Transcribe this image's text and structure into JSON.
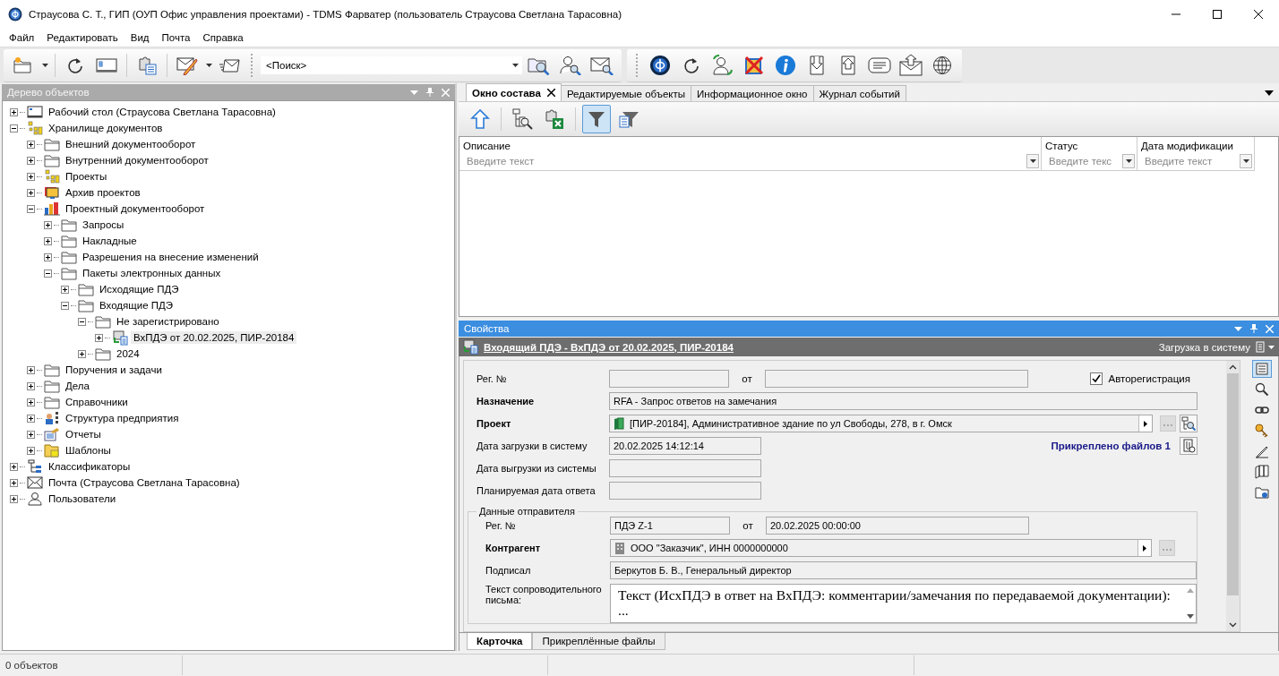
{
  "window": {
    "title": "Страусова С. Т., ГИП (ОУП Офис управления проектами) - TDMS Фарватер (пользователь Страусова Светлана Тарасовна)"
  },
  "menu": [
    "Файл",
    "Редактировать",
    "Вид",
    "Почта",
    "Справка"
  ],
  "search": {
    "value": "<Поиск>"
  },
  "tree_panel": {
    "title": "Дерево объектов"
  },
  "tree": [
    {
      "label": "Рабочий стол (Страусова Светлана Тарасовна)",
      "kind": "desktop",
      "expanded": false,
      "selected": false
    },
    {
      "label": "Хранилище документов",
      "kind": "storage",
      "expanded": true,
      "selected": false,
      "children": [
        {
          "label": "Внешний документооборот",
          "kind": "folder",
          "expanded": false,
          "selected": false
        },
        {
          "label": "Внутренний документооборот",
          "kind": "folder",
          "expanded": false,
          "selected": false
        },
        {
          "label": "Проекты",
          "kind": "storage",
          "expanded": false,
          "selected": false
        },
        {
          "label": "Архив проектов",
          "kind": "archive",
          "expanded": false,
          "selected": false
        },
        {
          "label": "Проектный документооборот",
          "kind": "chart",
          "expanded": true,
          "selected": false,
          "children": [
            {
              "label": "Запросы",
              "kind": "folder",
              "expanded": false,
              "selected": false
            },
            {
              "label": "Накладные",
              "kind": "folder",
              "expanded": false,
              "selected": false
            },
            {
              "label": "Разрешения на внесение изменений",
              "kind": "folder",
              "expanded": false,
              "selected": false
            },
            {
              "label": "Пакеты электронных данных",
              "kind": "folder",
              "expanded": true,
              "selected": false,
              "children": [
                {
                  "label": "Исходящие ПДЭ",
                  "kind": "folder",
                  "expanded": false,
                  "selected": false
                },
                {
                  "label": "Входящие ПДЭ",
                  "kind": "folder",
                  "expanded": true,
                  "selected": false,
                  "children": [
                    {
                      "label": "Не зарегистрировано",
                      "kind": "folder",
                      "expanded": true,
                      "selected": false,
                      "children": [
                        {
                          "label": "ВхПДЭ от 20.02.2025, ПИР-20184",
                          "kind": "package",
                          "expanded": false,
                          "selected": true
                        }
                      ]
                    },
                    {
                      "label": "2024",
                      "kind": "folder",
                      "expanded": false,
                      "selected": false
                    }
                  ]
                }
              ]
            }
          ]
        },
        {
          "label": "Поручения и задачи",
          "kind": "folder",
          "expanded": false,
          "selected": false
        },
        {
          "label": "Дела",
          "kind": "folder",
          "expanded": false,
          "selected": false
        },
        {
          "label": "Справочники",
          "kind": "folder",
          "expanded": false,
          "selected": false
        },
        {
          "label": "Структура предприятия",
          "kind": "structure",
          "expanded": false,
          "selected": false
        },
        {
          "label": "Отчеты",
          "kind": "reports",
          "expanded": false,
          "selected": false
        },
        {
          "label": "Шаблоны",
          "kind": "templates",
          "expanded": false,
          "selected": false
        }
      ]
    },
    {
      "label": "Классификаторы",
      "kind": "classifier",
      "expanded": false,
      "selected": false
    },
    {
      "label": "Почта (Страусова Светлана Тарасовна)",
      "kind": "mail",
      "expanded": false,
      "selected": false
    },
    {
      "label": "Пользователи",
      "kind": "user",
      "expanded": false,
      "selected": false
    }
  ],
  "tabs": [
    {
      "label": "Окно состава",
      "selected": true
    },
    {
      "label": "Редактируемые объекты",
      "selected": false
    },
    {
      "label": "Информационное окно",
      "selected": false
    },
    {
      "label": "Журнал событий",
      "selected": false
    }
  ],
  "composition_toolbar": {
    "filter_on": true
  },
  "table": {
    "columns": [
      {
        "name": "Описание",
        "placeholder": "Введите текст"
      },
      {
        "name": "Статус",
        "placeholder": "Введите текс"
      },
      {
        "name": "Дата модификации",
        "placeholder": "Введите текст"
      }
    ]
  },
  "properties": {
    "title": "Свойства",
    "card_title": "Входящий ПДЭ - ВхПДЭ от 20.02.2025, ПИР-20184",
    "stage": "Загрузка в систему",
    "rows": [
      {
        "kind": "pair",
        "label": "Рег. №",
        "bold": false,
        "between": "от",
        "checkbox": {
          "label": "Авторегистрация",
          "checked": true
        }
      },
      {
        "kind": "text",
        "label": "Назначение",
        "bold": true,
        "value": "RFA - Запрос ответов на замечания"
      },
      {
        "kind": "ref",
        "label": "Проект",
        "bold": true,
        "value": {
          "kind": "project",
          "text": "[ПИР-20184], Административное здание по ул Свободы, 278, в г. Омск"
        },
        "lookup": true
      },
      {
        "kind": "date",
        "label": "Дата загрузки в систему",
        "bold": false,
        "value": "20.02.2025 14:12:14",
        "link": "Прикреплено файлов 1"
      },
      {
        "kind": "date",
        "label": "Дата выгрузки из системы",
        "bold": false
      },
      {
        "kind": "date",
        "label": "Планируемая дата ответа",
        "bold": false
      }
    ],
    "sender": {
      "title": "Данные отправителя",
      "rows": [
        {
          "kind": "pair",
          "label": "Рег. №",
          "bold": false,
          "value": "ПДЭ Z-1",
          "between": "от",
          "value2": "20.02.2025 00:00:00"
        },
        {
          "kind": "ref",
          "label": "Контрагент",
          "bold": true,
          "value": {
            "kind": "company",
            "text": "ООО \"Заказчик\", ИНН 0000000000"
          },
          "lookup": false
        },
        {
          "kind": "text",
          "label": "Подписал",
          "bold": false,
          "value": "Беркутов Б. В., Генеральный директор"
        },
        {
          "kind": "memo",
          "label": "Текст сопроводительного письма:",
          "bold": false,
          "value": "Текст (ИсхПДЭ в ответ на ВхПДЭ: комментарии/замечания по передаваемой документации): ..."
        }
      ]
    },
    "side_tools": [
      {
        "selected": true
      },
      {
        "selected": false
      },
      {
        "selected": false
      },
      {
        "selected": false
      },
      {
        "selected": false
      },
      {
        "selected": false
      },
      {
        "selected": false
      }
    ],
    "tabs": [
      {
        "label": "Карточка",
        "selected": true
      },
      {
        "label": "Прикреплённые файлы",
        "selected": false
      }
    ]
  },
  "status_bar": {
    "text": "0 объектов"
  }
}
